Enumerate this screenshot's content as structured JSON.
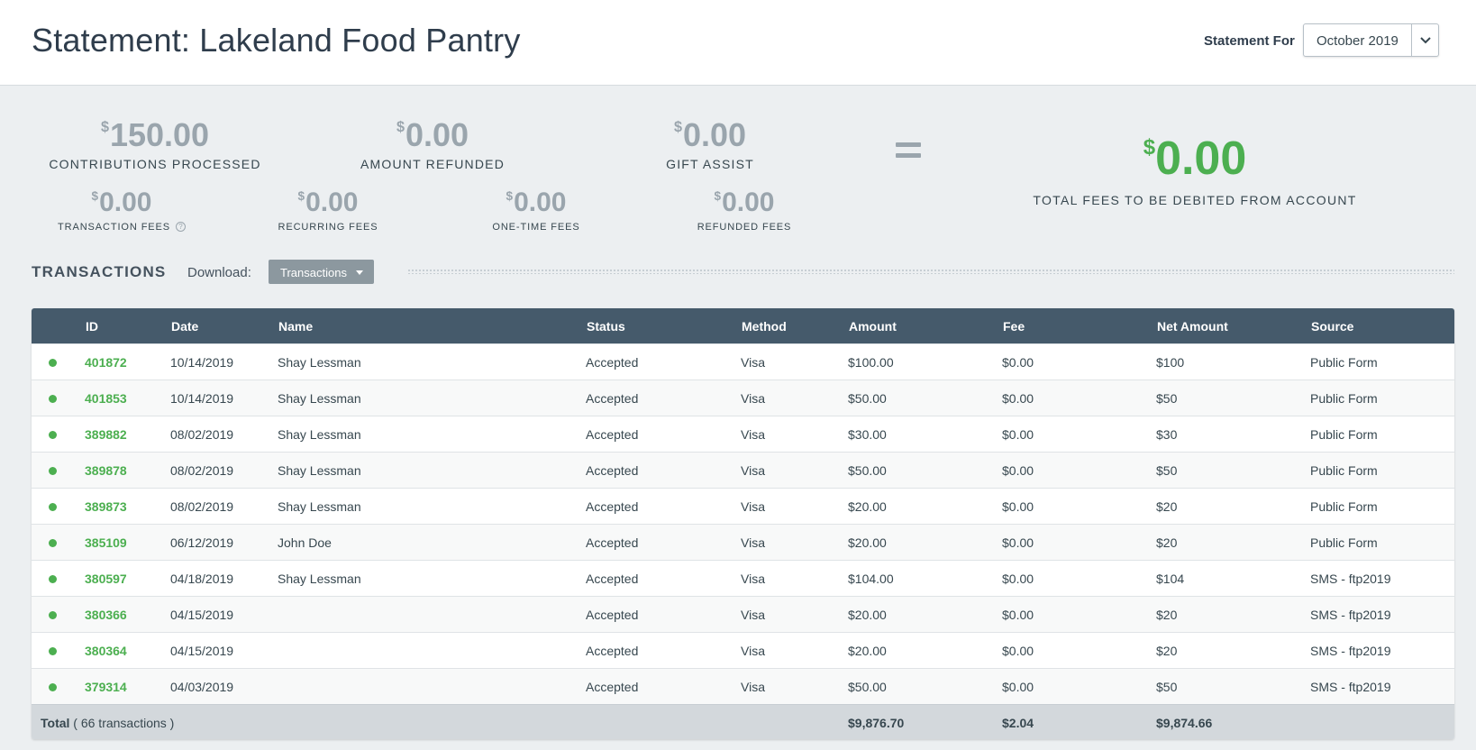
{
  "header": {
    "title": "Statement: Lakeland Food Pantry",
    "statement_for_label": "Statement For",
    "statement_for_value": "October 2019"
  },
  "summary": {
    "contributions": {
      "currency": "$",
      "amount": "150.00",
      "label": "CONTRIBUTIONS PROCESSED"
    },
    "refunded": {
      "currency": "$",
      "amount": "0.00",
      "label": "AMOUNT REFUNDED"
    },
    "gift_assist": {
      "currency": "$",
      "amount": "0.00",
      "label": "GIFT ASSIST"
    },
    "transaction_fees": {
      "currency": "$",
      "amount": "0.00",
      "label": "TRANSACTION FEES",
      "help_glyph": "?"
    },
    "recurring_fees": {
      "currency": "$",
      "amount": "0.00",
      "label": "RECURRING FEES"
    },
    "one_time_fees": {
      "currency": "$",
      "amount": "0.00",
      "label": "ONE-TIME FEES"
    },
    "refunded_fees": {
      "currency": "$",
      "amount": "0.00",
      "label": "REFUNDED FEES"
    },
    "total_fees": {
      "currency": "$",
      "amount": "0.00",
      "label": "TOTAL FEES TO BE DEBITED FROM ACCOUNT"
    }
  },
  "transactions": {
    "title": "TRANSACTIONS",
    "download_label": "Download:",
    "download_button": "Transactions",
    "columns": [
      "ID",
      "Date",
      "Name",
      "Status",
      "Method",
      "Amount",
      "Fee",
      "Net Amount",
      "Source"
    ],
    "rows": [
      {
        "id": "401872",
        "date": "10/14/2019",
        "name": "Shay Lessman",
        "status": "Accepted",
        "method": "Visa",
        "amount": "$100.00",
        "fee": "$0.00",
        "net": "$100",
        "source": "Public Form"
      },
      {
        "id": "401853",
        "date": "10/14/2019",
        "name": "Shay Lessman",
        "status": "Accepted",
        "method": "Visa",
        "amount": "$50.00",
        "fee": "$0.00",
        "net": "$50",
        "source": "Public Form"
      },
      {
        "id": "389882",
        "date": "08/02/2019",
        "name": "Shay Lessman",
        "status": "Accepted",
        "method": "Visa",
        "amount": "$30.00",
        "fee": "$0.00",
        "net": "$30",
        "source": "Public Form"
      },
      {
        "id": "389878",
        "date": "08/02/2019",
        "name": "Shay Lessman",
        "status": "Accepted",
        "method": "Visa",
        "amount": "$50.00",
        "fee": "$0.00",
        "net": "$50",
        "source": "Public Form"
      },
      {
        "id": "389873",
        "date": "08/02/2019",
        "name": "Shay Lessman",
        "status": "Accepted",
        "method": "Visa",
        "amount": "$20.00",
        "fee": "$0.00",
        "net": "$20",
        "source": "Public Form"
      },
      {
        "id": "385109",
        "date": "06/12/2019",
        "name": "John Doe",
        "status": "Accepted",
        "method": "Visa",
        "amount": "$20.00",
        "fee": "$0.00",
        "net": "$20",
        "source": "Public Form"
      },
      {
        "id": "380597",
        "date": "04/18/2019",
        "name": "Shay Lessman",
        "status": "Accepted",
        "method": "Visa",
        "amount": "$104.00",
        "fee": "$0.00",
        "net": "$104",
        "source": "SMS - ftp2019"
      },
      {
        "id": "380366",
        "date": "04/15/2019",
        "name": "",
        "status": "Accepted",
        "method": "Visa",
        "amount": "$20.00",
        "fee": "$0.00",
        "net": "$20",
        "source": "SMS - ftp2019"
      },
      {
        "id": "380364",
        "date": "04/15/2019",
        "name": "",
        "status": "Accepted",
        "method": "Visa",
        "amount": "$20.00",
        "fee": "$0.00",
        "net": "$20",
        "source": "SMS - ftp2019"
      },
      {
        "id": "379314",
        "date": "04/03/2019",
        "name": "",
        "status": "Accepted",
        "method": "Visa",
        "amount": "$50.00",
        "fee": "$0.00",
        "net": "$50",
        "source": "SMS - ftp2019"
      }
    ],
    "footer": {
      "total_label": "Total",
      "count_text": "( 66 transactions )",
      "amount": "$9,876.70",
      "fee": "$2.04",
      "net": "$9,874.66"
    }
  },
  "colors": {
    "accent_green": "#4caf50",
    "table_header": "#455a6b",
    "muted_amount": "#9aa5ad"
  },
  "icons": {
    "select_arrow": "chevron-down-icon",
    "download_caret": "caret-down-icon",
    "status_dot": "status-dot-icon",
    "help": "help-icon"
  }
}
